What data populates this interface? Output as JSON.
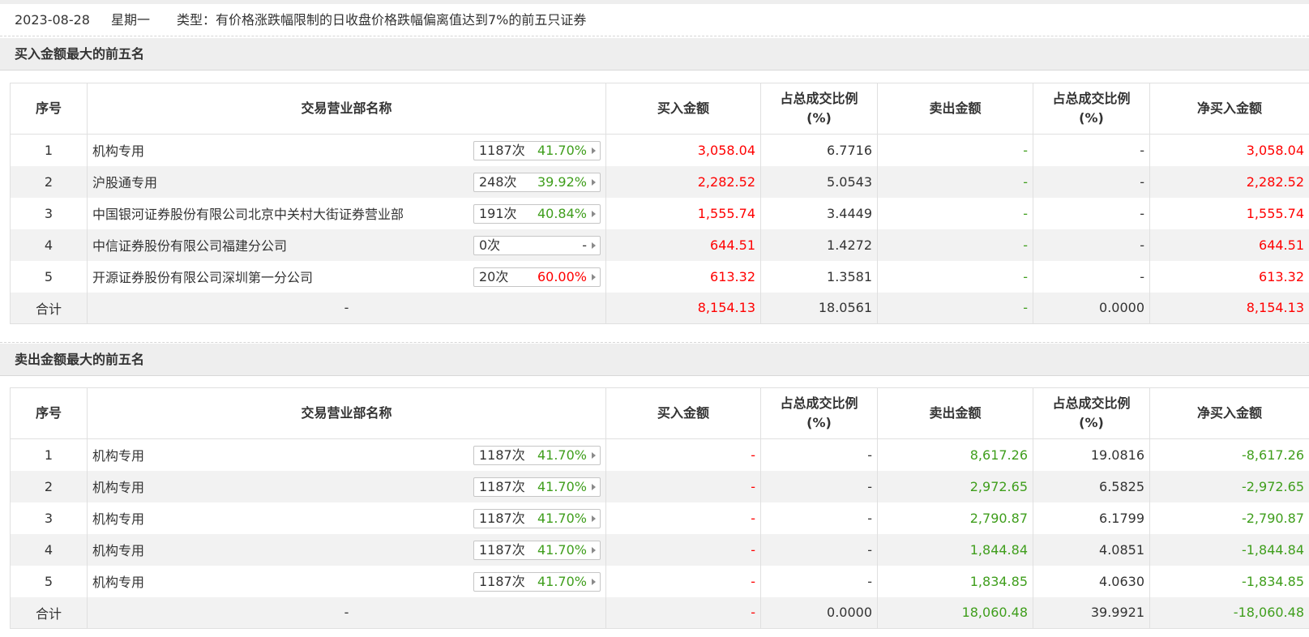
{
  "info": {
    "date": "2023-08-28",
    "weekday": "星期一",
    "type_label": "类型：有价格涨跌幅限制的日收盘价格跌幅偏离值达到7%的前五只证券"
  },
  "colors": {
    "up": "#ff0000",
    "down": "#3f9e1c",
    "header_bg": "#eeeeee",
    "row_alt_bg": "#f2f2f2"
  },
  "headers": {
    "seq": "序号",
    "name": "交易营业部名称",
    "buy": "买入金额",
    "buy_ratio_1": "占总成交比例",
    "buy_ratio_2": "(%)",
    "sell": "卖出金额",
    "sell_ratio_1": "占总成交比例",
    "sell_ratio_2": "(%)",
    "net": "净买入金额"
  },
  "buy_section": {
    "title": "买入金额最大的前五名",
    "rows": [
      {
        "seq": "1",
        "name": "机构专用",
        "count": "1187次",
        "pct": "41.70%",
        "pct_color": "green",
        "buy": "3,058.04",
        "buy_ratio": "6.7716",
        "sell": "-",
        "sell_ratio": "-",
        "net": "3,058.04",
        "net_color": "red"
      },
      {
        "seq": "2",
        "name": "沪股通专用",
        "count": "248次",
        "pct": "39.92%",
        "pct_color": "green",
        "buy": "2,282.52",
        "buy_ratio": "5.0543",
        "sell": "-",
        "sell_ratio": "-",
        "net": "2,282.52",
        "net_color": "red"
      },
      {
        "seq": "3",
        "name": "中国银河证券股份有限公司北京中关村大街证券营业部",
        "count": "191次",
        "pct": "40.84%",
        "pct_color": "green",
        "buy": "1,555.74",
        "buy_ratio": "3.4449",
        "sell": "-",
        "sell_ratio": "-",
        "net": "1,555.74",
        "net_color": "red"
      },
      {
        "seq": "4",
        "name": "中信证券股份有限公司福建分公司",
        "count": "0次",
        "pct": "-",
        "pct_color": "dark",
        "buy": "644.51",
        "buy_ratio": "1.4272",
        "sell": "-",
        "sell_ratio": "-",
        "net": "644.51",
        "net_color": "red"
      },
      {
        "seq": "5",
        "name": "开源证券股份有限公司深圳第一分公司",
        "count": "20次",
        "pct": "60.00%",
        "pct_color": "red",
        "buy": "613.32",
        "buy_ratio": "1.3581",
        "sell": "-",
        "sell_ratio": "-",
        "net": "613.32",
        "net_color": "red"
      }
    ],
    "total": {
      "label": "合计",
      "name": "-",
      "buy": "8,154.13",
      "buy_ratio": "18.0561",
      "sell": "-",
      "sell_ratio": "0.0000",
      "net": "8,154.13",
      "net_color": "red"
    }
  },
  "sell_section": {
    "title": "卖出金额最大的前五名",
    "rows": [
      {
        "seq": "1",
        "name": "机构专用",
        "count": "1187次",
        "pct": "41.70%",
        "pct_color": "green",
        "buy": "-",
        "buy_ratio": "-",
        "sell": "8,617.26",
        "sell_ratio": "19.0816",
        "net": "-8,617.26",
        "net_color": "green"
      },
      {
        "seq": "2",
        "name": "机构专用",
        "count": "1187次",
        "pct": "41.70%",
        "pct_color": "green",
        "buy": "-",
        "buy_ratio": "-",
        "sell": "2,972.65",
        "sell_ratio": "6.5825",
        "net": "-2,972.65",
        "net_color": "green"
      },
      {
        "seq": "3",
        "name": "机构专用",
        "count": "1187次",
        "pct": "41.70%",
        "pct_color": "green",
        "buy": "-",
        "buy_ratio": "-",
        "sell": "2,790.87",
        "sell_ratio": "6.1799",
        "net": "-2,790.87",
        "net_color": "green"
      },
      {
        "seq": "4",
        "name": "机构专用",
        "count": "1187次",
        "pct": "41.70%",
        "pct_color": "green",
        "buy": "-",
        "buy_ratio": "-",
        "sell": "1,844.84",
        "sell_ratio": "4.0851",
        "net": "-1,844.84",
        "net_color": "green"
      },
      {
        "seq": "5",
        "name": "机构专用",
        "count": "1187次",
        "pct": "41.70%",
        "pct_color": "green",
        "buy": "-",
        "buy_ratio": "-",
        "sell": "1,834.85",
        "sell_ratio": "4.0630",
        "net": "-1,834.85",
        "net_color": "green"
      }
    ],
    "total": {
      "label": "合计",
      "name": "-",
      "buy": "-",
      "buy_ratio": "0.0000",
      "sell": "18,060.48",
      "sell_ratio": "39.9921",
      "net": "-18,060.48",
      "net_color": "green"
    }
  }
}
